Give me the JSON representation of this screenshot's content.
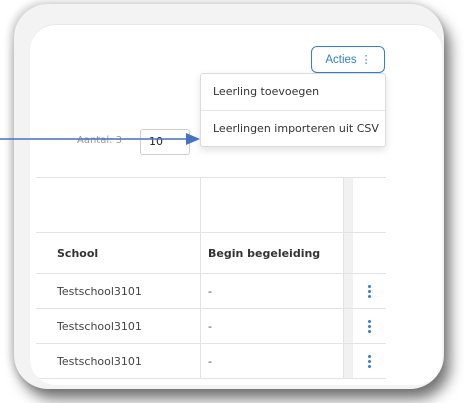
{
  "actions": {
    "label": "Acties",
    "icon": "kebab-vertical-icon"
  },
  "dropdown": {
    "items": [
      {
        "label": "Leerling toevoegen"
      },
      {
        "label": "Leerlingen importeren uit CSV"
      }
    ]
  },
  "pagination": {
    "count_label": "Aantal: 3",
    "page_size": "10"
  },
  "table": {
    "columns": [
      "School",
      "Begin begeleiding"
    ],
    "rows": [
      {
        "school": "Testschool3101",
        "begin": "-"
      },
      {
        "school": "Testschool3101",
        "begin": "-"
      },
      {
        "school": "Testschool3101",
        "begin": "-"
      }
    ]
  },
  "annotation": {
    "arrow_color": "#4472c4"
  },
  "colors": {
    "accent": "#2f80d1"
  }
}
